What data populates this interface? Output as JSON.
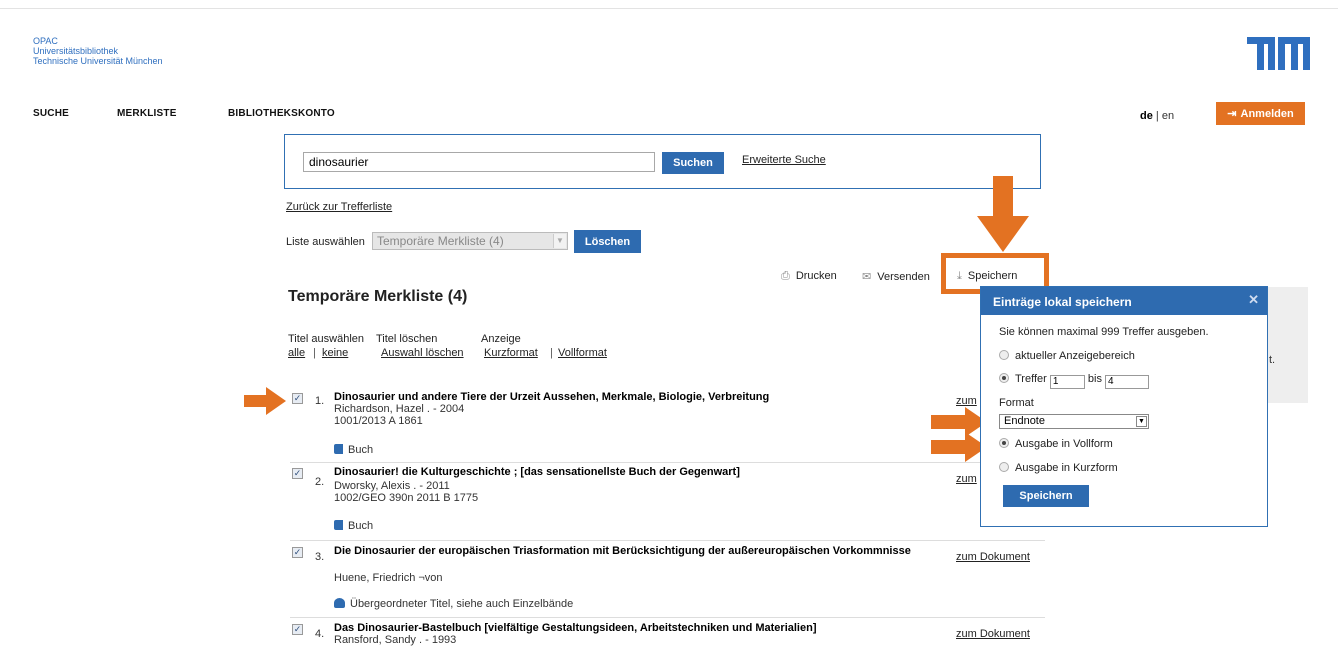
{
  "header": {
    "brand_line1": "OPAC",
    "brand_line2": "Universitätsbibliothek",
    "brand_line3": "Technische Universität München",
    "logo_text": "TUM"
  },
  "nav": {
    "items": [
      "SUCHE",
      "MERKLISTE",
      "BIBLIOTHEKSKONTO"
    ],
    "lang_de": "de",
    "lang_sep": "|",
    "lang_en": "en",
    "login_label": "Anmelden"
  },
  "search": {
    "value": "dinosaurier",
    "button_label": "Suchen",
    "advanced_link": "Erweiterte Suche"
  },
  "back_link": "Zurück zur Trefferliste",
  "list_select": {
    "label": "Liste auswählen",
    "selected": "Temporäre Merkliste (4)",
    "delete_label": "Löschen"
  },
  "tools": {
    "print": "Drucken",
    "send": "Versenden",
    "save": "Speichern"
  },
  "page_title": "Temporäre Merkliste (4)",
  "selection": {
    "select_title_label": "Titel auswählen",
    "delete_title_label": "Titel löschen",
    "display_label": "Anzeige",
    "all": "alle",
    "none": "keine",
    "delete_selection": "Auswahl löschen",
    "short_format": "Kurzformat",
    "full_format": "Vollformat"
  },
  "results": [
    {
      "num": "1.",
      "title": "Dinosaurier und andere Tiere der Urzeit Aussehen, Merkmale, Biologie, Verbreitung",
      "author": "Richardson, Hazel . - 2004",
      "signature": "1001/2013 A 1861",
      "type": "Buch",
      "link": "zum"
    },
    {
      "num": "2.",
      "title": "Dinosaurier! die Kulturgeschichte ; [das sensationellste Buch der Gegenwart]",
      "author": "Dworsky, Alexis . - 2011",
      "signature": "1002/GEO 390n 2011 B 1775",
      "type": "Buch",
      "link": "zum"
    },
    {
      "num": "3.",
      "title": "Die Dinosaurier der europäischen Triasformation mit Berücksichtigung der außereuropäischen Vorkommnisse",
      "author": "Huene, Friedrich ¬von",
      "signature": "",
      "type": "Übergeordneter Titel, siehe auch Einzelbände",
      "link": "zum Dokument"
    },
    {
      "num": "4.",
      "title": "Das Dinosaurier-Bastelbuch [vielfältige Gestaltungsideen, Arbeitstechniken und Materialien]",
      "author": "Ransford, Sandy . - 1993",
      "signature": "",
      "type": "",
      "link": "zum Dokument"
    }
  ],
  "right_panel_fragment": "t.",
  "popup": {
    "title": "Einträge lokal speichern",
    "close": "✕",
    "max_text": "Sie können maximal 999 Treffer ausgeben.",
    "option_current": "aktueller Anzeigebereich",
    "option_hits": "Treffer",
    "hits_from": "1",
    "hits_to_label": "bis",
    "hits_to": "4",
    "format_label": "Format",
    "format_value": "Endnote",
    "option_full": "Ausgabe in Vollform",
    "option_short": "Ausgabe in Kurzform",
    "save_label": "Speichern"
  },
  "colors": {
    "accent_orange": "#e37222",
    "primary_blue": "#2e6bb0",
    "brand_blue": "#2f6fbf"
  }
}
